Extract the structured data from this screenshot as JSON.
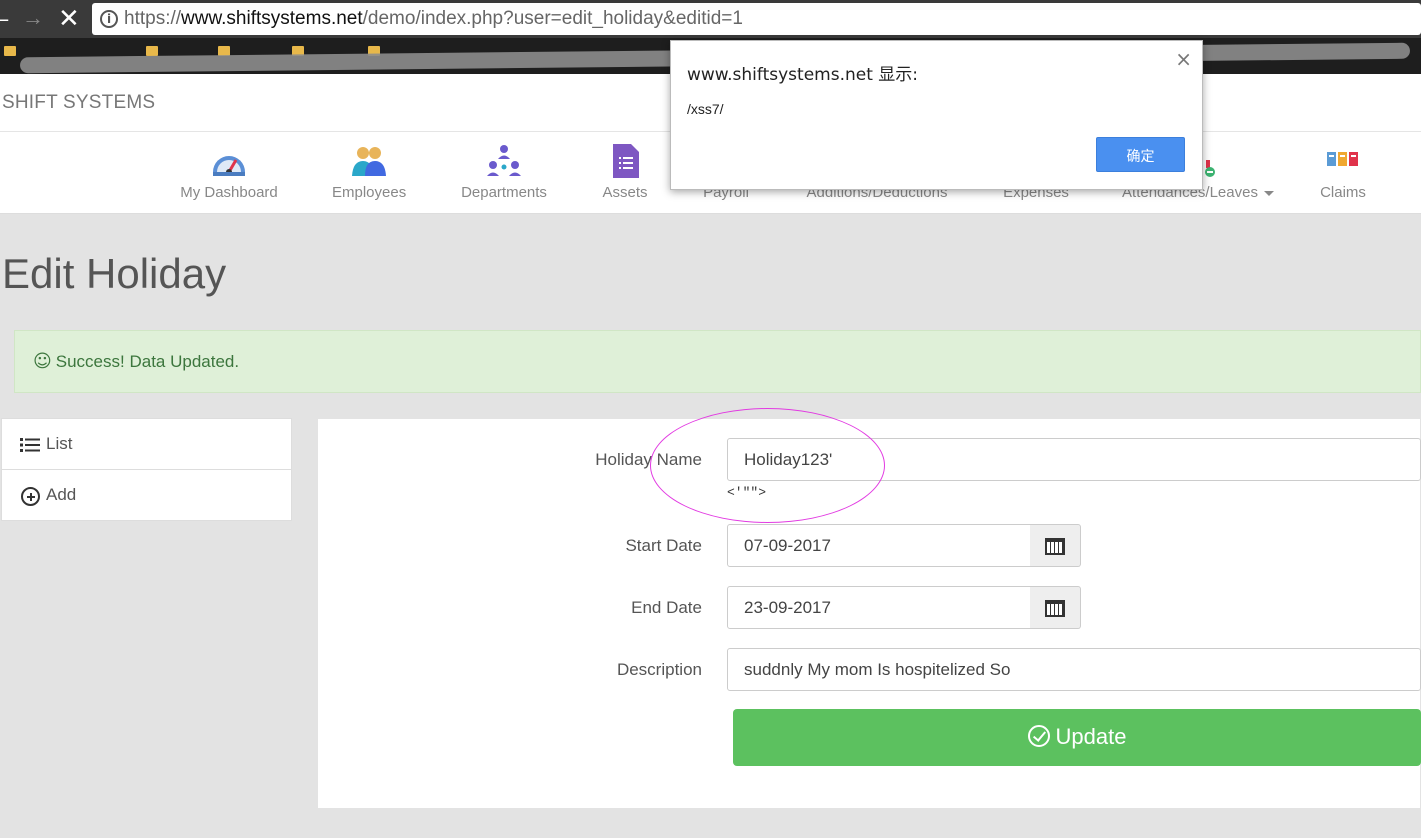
{
  "browser": {
    "url_prefix": "https://",
    "url_host": "www.shiftsystems.net",
    "url_path": "/demo/index.php?user=edit_holiday&editid=1"
  },
  "app": {
    "brand": "SHIFT SYSTEMS"
  },
  "menu": {
    "dashboard": "My Dashboard",
    "employees": "Employees",
    "departments": "Departments",
    "assets": "Assets",
    "payroll": "Payroll",
    "additions": "Additions/Deductions",
    "expenses": "Expenses",
    "attendances": "Attendances/Leaves",
    "claims": "Claims"
  },
  "page": {
    "title": "Edit Holiday",
    "alert": "Success! Data Updated."
  },
  "sidebar": {
    "list": "List",
    "add": "Add"
  },
  "form": {
    "holiday_name_label": "Holiday Name",
    "holiday_name_value": "Holiday123'",
    "xss_note": "<'\"\">",
    "start_date_label": "Start Date",
    "start_date_value": "07-09-2017",
    "end_date_label": "End Date",
    "end_date_value": "23-09-2017",
    "description_label": "Description",
    "description_value": "suddnly My  mom Is hospitelized So",
    "update_label": "Update"
  },
  "dialog": {
    "title": "www.shiftsystems.net 显示:",
    "message": "/xss7/",
    "ok": "确定",
    "close": "×"
  },
  "colors": {
    "success_bg": "#dff0d8",
    "button_green": "#5cc15f",
    "dialog_ok": "#4a90f0",
    "annotation": "#e23be2"
  }
}
